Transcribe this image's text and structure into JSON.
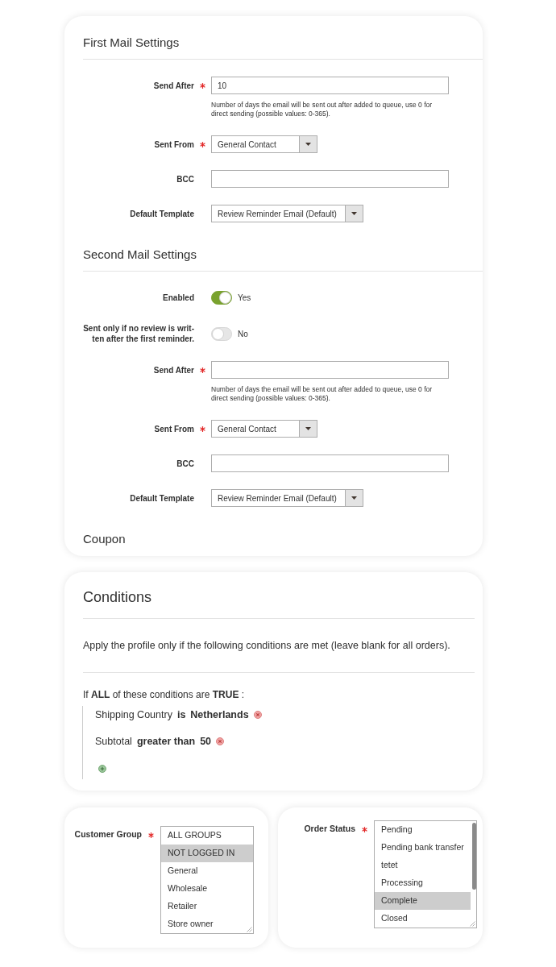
{
  "sections": [
    {
      "title": "First Mail Settings",
      "fields": [
        {
          "kind": "text",
          "label": "Send After",
          "required": true,
          "value": "10",
          "note": "Number of days the email will be sent out after added to queue, use 0 for direct sending (possible values: 0-365)."
        },
        {
          "kind": "select",
          "label": "Sent From",
          "required": true,
          "value": "General Contact"
        },
        {
          "kind": "text",
          "label": "BCC",
          "required": false
        },
        {
          "kind": "select",
          "label": "Default Template",
          "required": false,
          "value": "Review Reminder Email (Default)"
        }
      ]
    },
    {
      "title": "Second Mail Settings",
      "fields": [
        {
          "kind": "toggle",
          "label": "Enabled",
          "required": false,
          "on": true,
          "value": "Yes"
        },
        {
          "kind": "toggle",
          "label": "Sent only if no review is writ-ten after the first reminder.",
          "required": false,
          "on": false,
          "value": "No"
        },
        {
          "kind": "text",
          "label": "Send After",
          "required": true,
          "note": "Number of days the email will be sent out after added to queue, use 0 for direct sending (possible values: 0-365)."
        },
        {
          "kind": "select",
          "label": "Sent From",
          "required": true,
          "value": "General Contact"
        },
        {
          "kind": "text",
          "label": "BCC",
          "required": false
        },
        {
          "kind": "select",
          "label": "Default Template",
          "required": false,
          "value": "Review Reminder Email (Default)"
        }
      ]
    },
    {
      "title": "Coupon"
    }
  ],
  "conditions": {
    "title": "Conditions",
    "description": "Apply the profile only if the following conditions are met (leave blank for all orders).",
    "rule": {
      "prefix": "If",
      "aggregator": "ALL",
      "middle": "of these conditions are",
      "value": "TRUE",
      "suffix": ":"
    },
    "items": [
      {
        "attribute": "Shipping Country",
        "operator": "is",
        "value": "Netherlands"
      },
      {
        "attribute": "Subtotal",
        "operator": "greater than",
        "value": "50"
      }
    ]
  },
  "customer_group": {
    "label": "Customer Group",
    "required": true,
    "options": [
      {
        "label": "ALL GROUPS",
        "selected": false
      },
      {
        "label": "NOT LOGGED IN",
        "selected": true
      },
      {
        "label": "General",
        "selected": false
      },
      {
        "label": "Wholesale",
        "selected": false
      },
      {
        "label": "Retailer",
        "selected": false
      },
      {
        "label": "Store owner",
        "selected": false
      }
    ]
  },
  "order_status": {
    "label": "Order Status",
    "required": true,
    "options": [
      {
        "label": "Pending",
        "selected": false
      },
      {
        "label": "Pending bank transfer",
        "selected": false
      },
      {
        "label": "tetet",
        "selected": false
      },
      {
        "label": "Processing",
        "selected": false
      },
      {
        "label": "Complete",
        "selected": true
      },
      {
        "label": "Closed",
        "selected": false
      }
    ]
  }
}
